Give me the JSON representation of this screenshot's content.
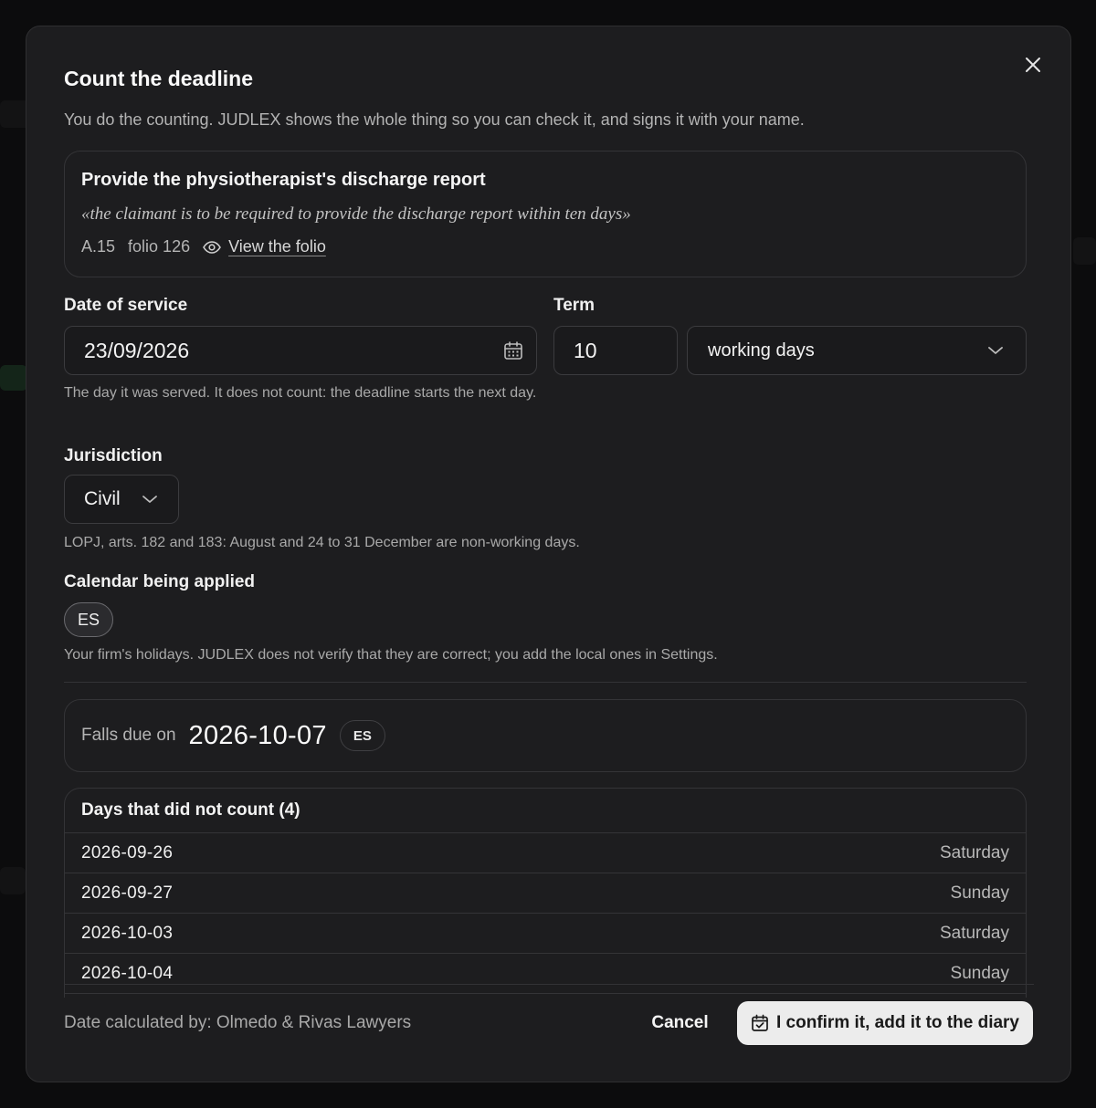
{
  "dialog": {
    "title": "Count the deadline",
    "subtitle": "You do the counting. JUDLEX shows the whole thing so you can check it, and signs it with your name."
  },
  "task": {
    "title": "Provide the physiotherapist's discharge report",
    "quote": "«the claimant is to be required to provide the discharge report within ten days»",
    "ref": "A.15",
    "folio": "folio 126",
    "view_link": "View the folio"
  },
  "date_of_service": {
    "label": "Date of service",
    "value": "23/09/2026",
    "hint": "The day it was served. It does not count: the deadline starts the next day."
  },
  "term": {
    "label": "Term",
    "value": "10",
    "unit": "working days"
  },
  "jurisdiction": {
    "label": "Jurisdiction",
    "value": "Civil",
    "hint": "LOPJ, arts. 182 and 183: August and 24 to 31 December are non-working days."
  },
  "calendar": {
    "label": "Calendar being applied",
    "pill": "ES",
    "hint": "Your firm's holidays. JUDLEX does not verify that they are correct; you add the local ones in Settings."
  },
  "result": {
    "label": "Falls due on",
    "date": "2026-10-07",
    "badge": "ES"
  },
  "skipped": {
    "title": "Days that did not count (4)",
    "rows": [
      {
        "date": "2026-09-26",
        "weekday": "Saturday"
      },
      {
        "date": "2026-09-27",
        "weekday": "Sunday"
      },
      {
        "date": "2026-10-03",
        "weekday": "Saturday"
      },
      {
        "date": "2026-10-04",
        "weekday": "Sunday"
      }
    ]
  },
  "footer": {
    "calculated_by": "Date calculated by: Olmedo & Rivas Lawyers",
    "cancel": "Cancel",
    "confirm": "I confirm it, add it to the diary"
  },
  "icons": {
    "close": "close-icon",
    "eye": "eye-icon",
    "calendar": "calendar-icon",
    "chevron": "chevron-down-icon",
    "calendar_check": "calendar-check-icon"
  }
}
